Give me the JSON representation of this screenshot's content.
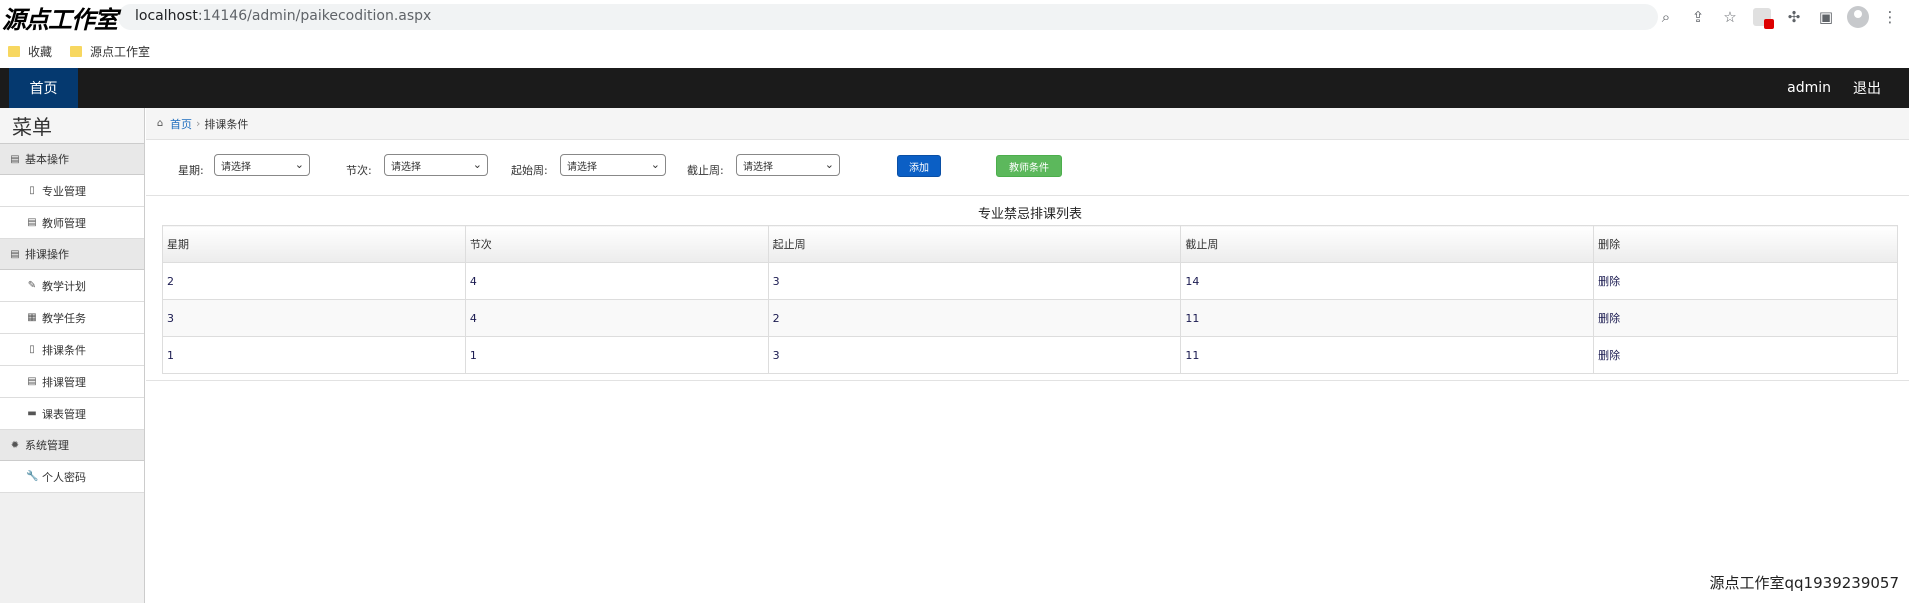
{
  "browser": {
    "watermark": "源点工作室",
    "url_host": "localhost",
    "url_path": ":14146/admin/paikecodition.aspx",
    "bookmarks": [
      "收藏",
      "源点工作室"
    ]
  },
  "header": {
    "home": "首页",
    "user": "admin",
    "logout": "退出"
  },
  "sidebar": {
    "title": "菜单",
    "groups": [
      {
        "label": "基本操作",
        "icon": "book-icon",
        "items": [
          {
            "label": "专业管理",
            "icon": "file-icon"
          },
          {
            "label": "教师管理",
            "icon": "list-icon"
          }
        ]
      },
      {
        "label": "排课操作",
        "icon": "book-icon",
        "items": [
          {
            "label": "教学计划",
            "icon": "leaf-icon"
          },
          {
            "label": "教学任务",
            "icon": "image-icon"
          },
          {
            "label": "排课条件",
            "icon": "file-icon"
          },
          {
            "label": "排课管理",
            "icon": "list-icon"
          },
          {
            "label": "课表管理",
            "icon": "truck-icon"
          }
        ]
      },
      {
        "label": "系统管理",
        "icon": "gear-icon",
        "items": [
          {
            "label": "个人密码",
            "icon": "wrench-icon"
          }
        ]
      }
    ]
  },
  "breadcrumb": {
    "home": "首页",
    "current": "排课条件"
  },
  "filters": {
    "weekday_label": "星期:",
    "session_label": "节次:",
    "start_week_label": "起始周:",
    "end_week_label": "截止周:",
    "placeholder": "请选择",
    "add_button": "添加",
    "teacher_button": "教师条件"
  },
  "table": {
    "caption": "专业禁忌排课列表",
    "headers": [
      "星期",
      "节次",
      "起止周",
      "截止周",
      "删除"
    ],
    "rows": [
      [
        "2",
        "4",
        "3",
        "14",
        "删除"
      ],
      [
        "3",
        "4",
        "2",
        "11",
        "删除"
      ],
      [
        "1",
        "1",
        "3",
        "11",
        "删除"
      ]
    ]
  },
  "footer_note": "源点工作室qq1939239057",
  "colors": {
    "nav_bg": "#1b1b1b",
    "home_tab": "#05396f",
    "add_btn": "#0b5fc5",
    "teacher_btn": "#5cb85c"
  }
}
